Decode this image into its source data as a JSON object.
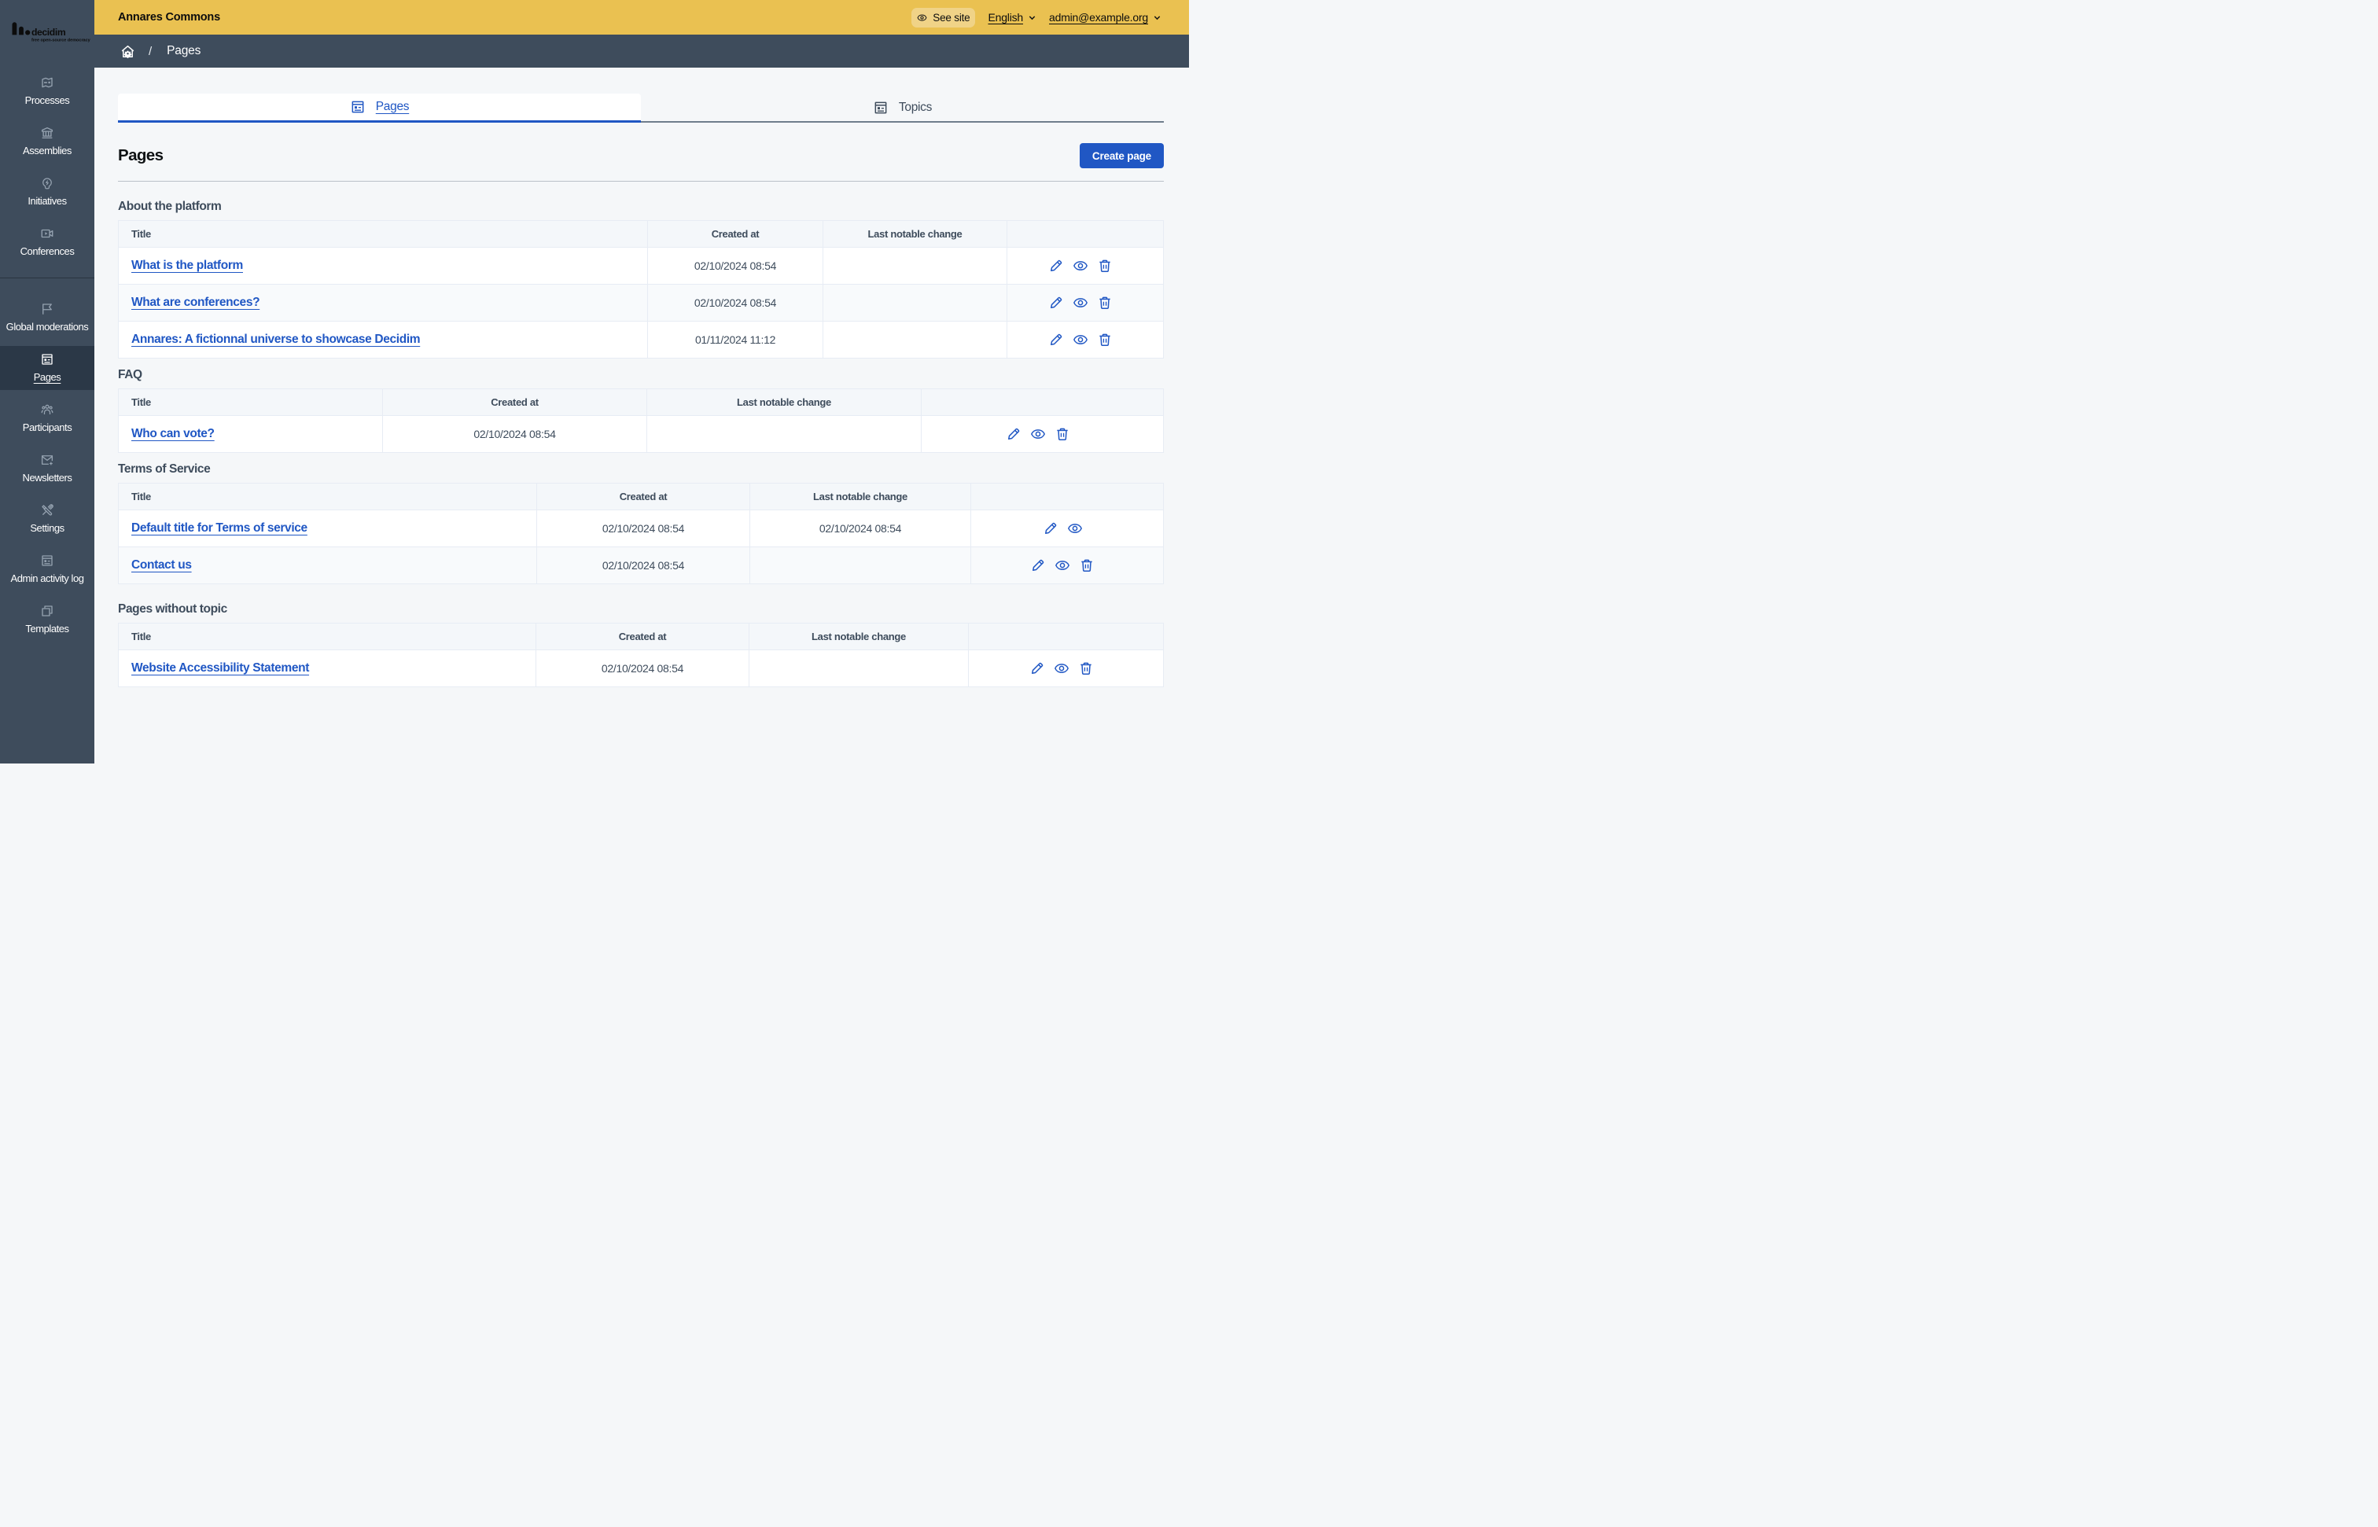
{
  "brand": {
    "logo_text": "decidim",
    "logo_tagline": "free open-source democracy"
  },
  "sidebar": {
    "items": [
      {
        "label": "Processes",
        "icon": "map-icon",
        "active": false
      },
      {
        "label": "Assemblies",
        "icon": "government-icon",
        "active": false
      },
      {
        "label": "Initiatives",
        "icon": "lightbulb-flash-icon",
        "active": false
      },
      {
        "label": "Conferences",
        "icon": "video-camera-icon",
        "active": false
      },
      {
        "label": "Global moderations",
        "icon": "flag-icon",
        "active": false
      },
      {
        "label": "Pages",
        "icon": "pages-icon",
        "active": true
      },
      {
        "label": "Participants",
        "icon": "team-icon",
        "active": false
      },
      {
        "label": "Newsletters",
        "icon": "mail-add-icon",
        "active": false
      },
      {
        "label": "Settings",
        "icon": "tools-icon",
        "active": false
      },
      {
        "label": "Admin activity log",
        "icon": "article-icon",
        "active": false
      },
      {
        "label": "Templates",
        "icon": "file-copy-icon",
        "active": false
      }
    ]
  },
  "topbar": {
    "title": "Annares Commons",
    "see_site": "See site",
    "language": "English",
    "user": "admin@example.org"
  },
  "breadcrumb": {
    "separator": "/",
    "current": "Pages"
  },
  "tabs": [
    {
      "label": "Pages",
      "active": true
    },
    {
      "label": "Topics",
      "active": false
    }
  ],
  "page": {
    "title": "Pages",
    "create_button": "Create page"
  },
  "sections": [
    {
      "title": "About the platform",
      "columns": [
        "Title",
        "Created at",
        "Last notable change"
      ],
      "rows": [
        {
          "title": "What is the platform",
          "created_at": "02/10/2024 08:54",
          "last_change": "",
          "actions": [
            "edit",
            "preview",
            "delete"
          ]
        },
        {
          "title": "What are conferences?",
          "created_at": "02/10/2024 08:54",
          "last_change": "",
          "actions": [
            "edit",
            "preview",
            "delete"
          ]
        },
        {
          "title": "Annares: A fictionnal universe to showcase Decidim",
          "created_at": "01/11/2024 11:12",
          "last_change": "",
          "actions": [
            "edit",
            "preview",
            "delete"
          ]
        }
      ]
    },
    {
      "title": "FAQ",
      "columns": [
        "Title",
        "Created at",
        "Last notable change"
      ],
      "rows": [
        {
          "title": "Who can vote?",
          "created_at": "02/10/2024 08:54",
          "last_change": "",
          "actions": [
            "edit",
            "preview",
            "delete"
          ]
        }
      ]
    },
    {
      "title": "Terms of Service",
      "columns": [
        "Title",
        "Created at",
        "Last notable change"
      ],
      "rows": [
        {
          "title": "Default title for Terms of service",
          "created_at": "02/10/2024 08:54",
          "last_change": "02/10/2024 08:54",
          "actions": [
            "edit",
            "preview"
          ]
        },
        {
          "title": "Contact us",
          "created_at": "02/10/2024 08:54",
          "last_change": "",
          "actions": [
            "edit",
            "preview",
            "delete"
          ]
        }
      ]
    },
    {
      "title": "Pages without topic",
      "columns": [
        "Title",
        "Created at",
        "Last notable change"
      ],
      "rows": [
        {
          "title": "Website Accessibility Statement",
          "created_at": "02/10/2024 08:54",
          "last_change": "",
          "actions": [
            "edit",
            "preview",
            "delete"
          ]
        }
      ]
    }
  ],
  "colors": {
    "sidebar": "#3e4c5c",
    "sidebar_active": "#2b3847",
    "topbar": "#eac151",
    "see_site_chip": "#f0d387",
    "primary_blue": "#2057c4",
    "page_background": "#f5f7f9",
    "table_header_background": "#f4f7fa",
    "table_border": "#e7ecf4"
  }
}
